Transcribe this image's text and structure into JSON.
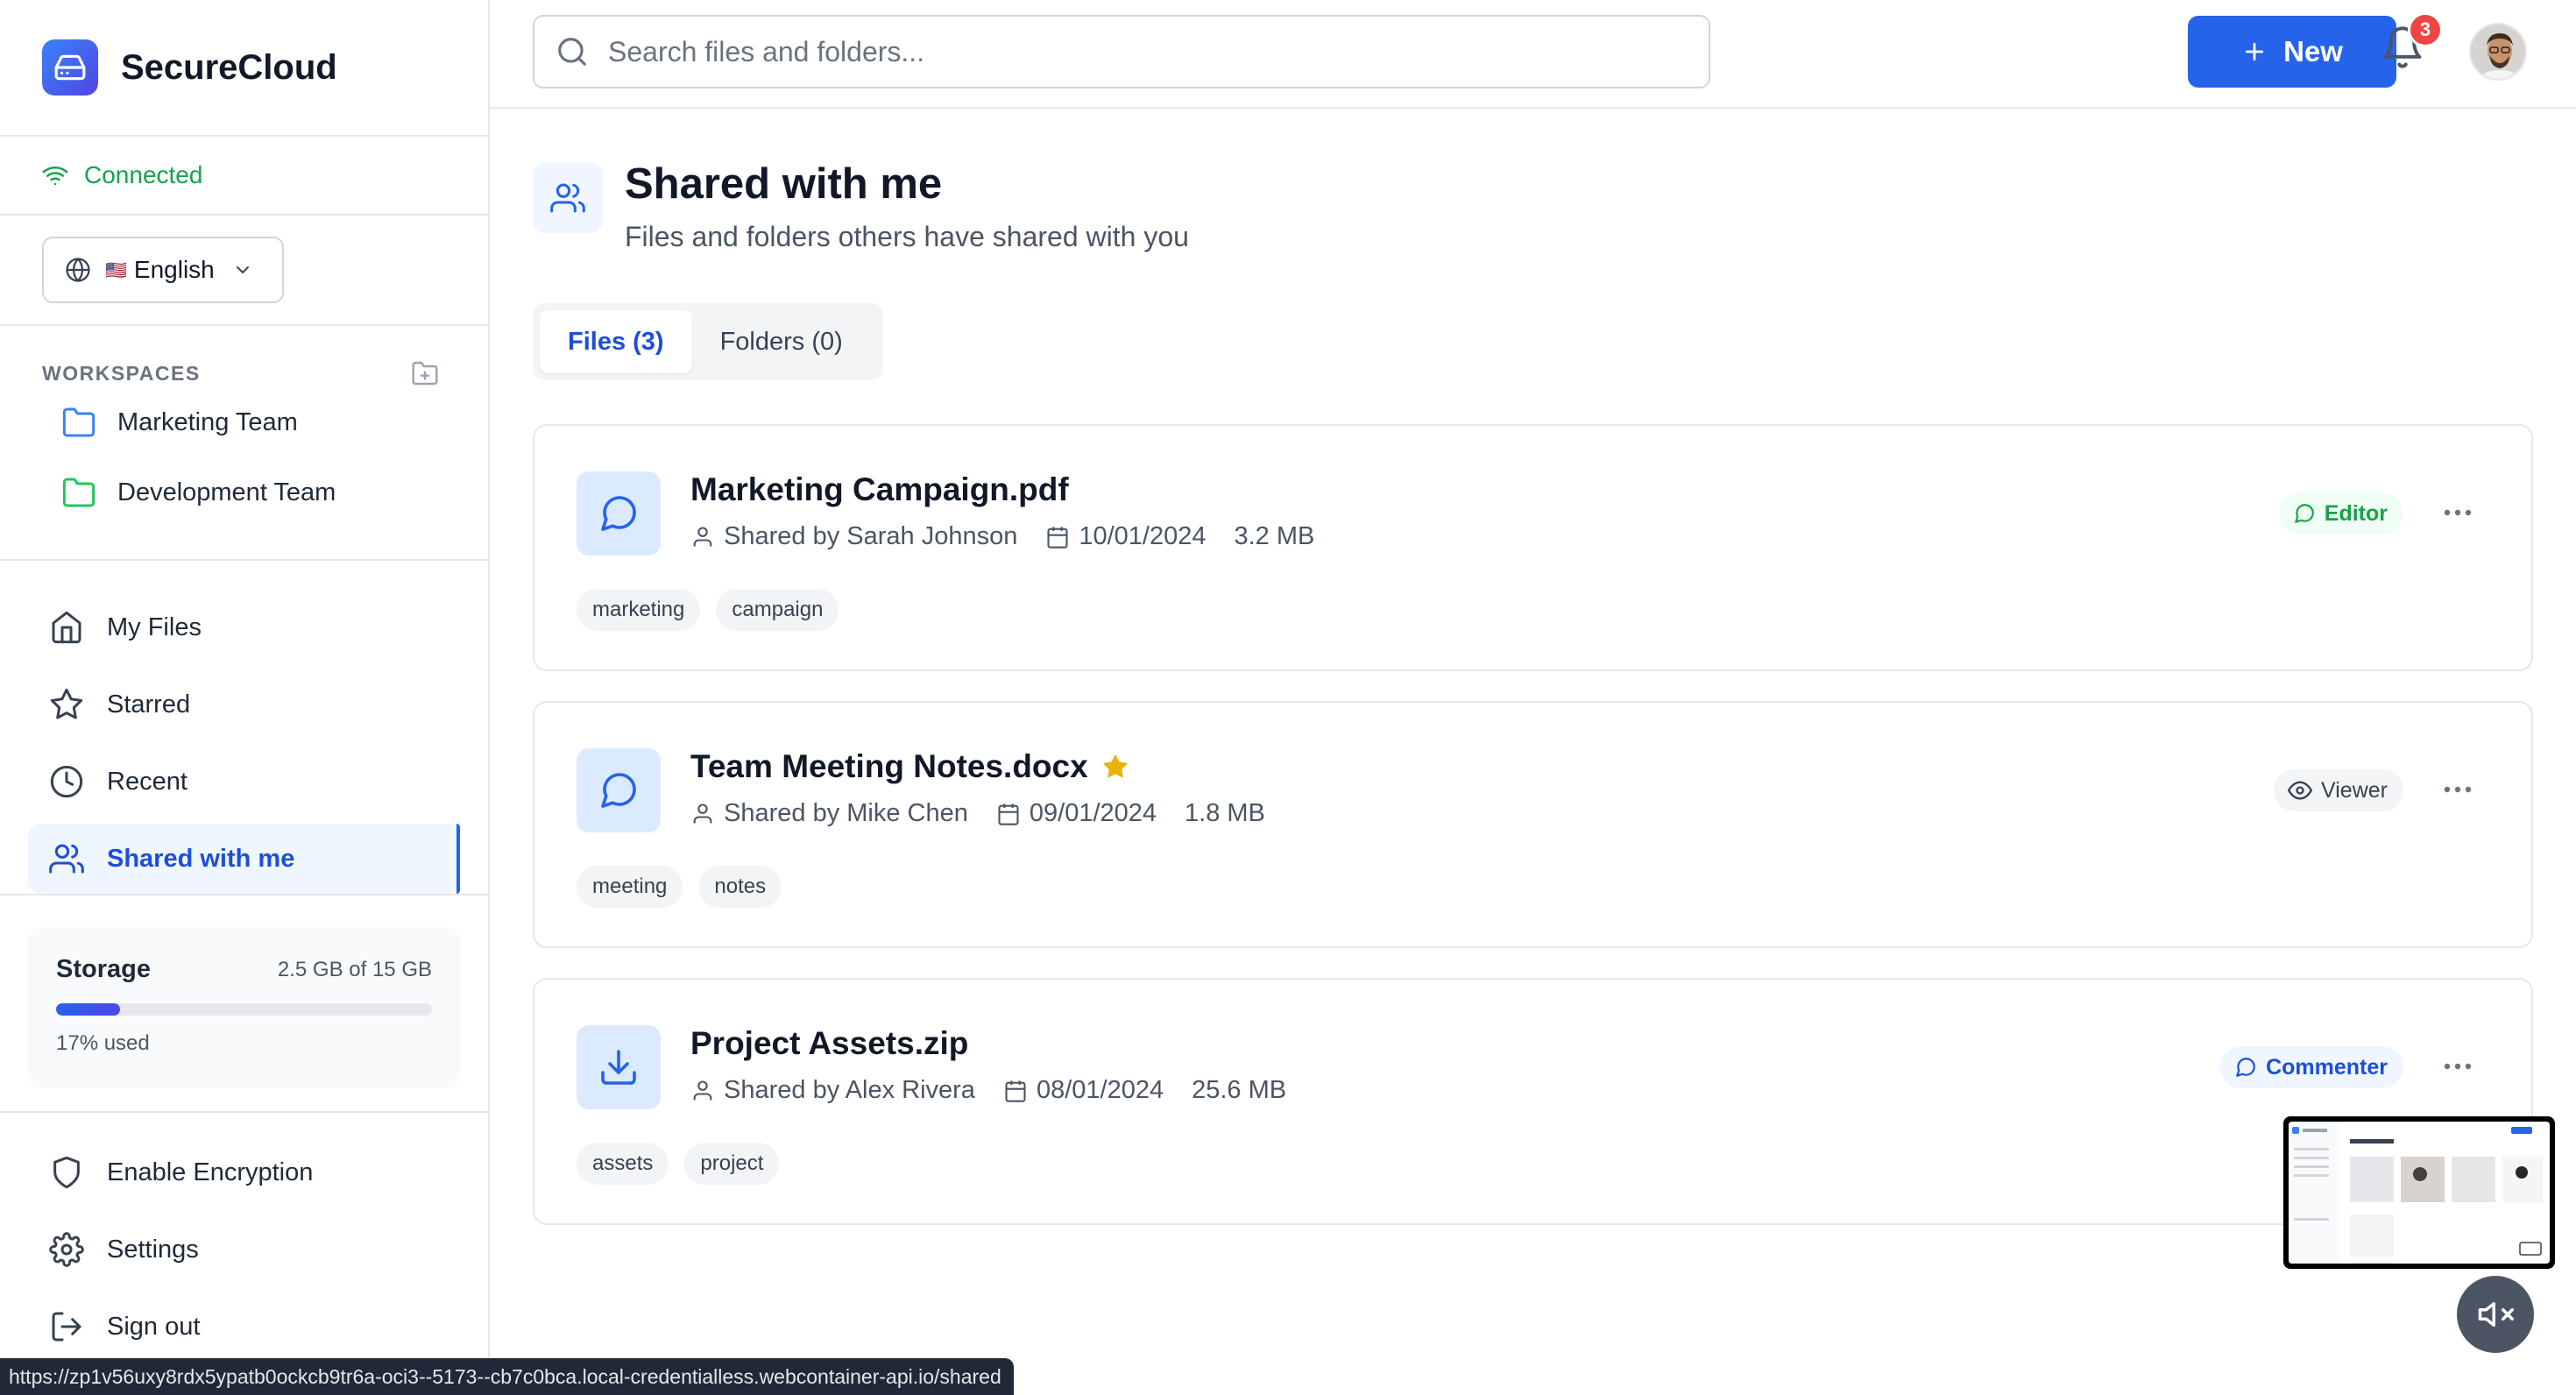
{
  "brand": {
    "name": "SecureCloud"
  },
  "connection": {
    "status": "Connected"
  },
  "language": {
    "flag": "🇺🇸",
    "label": "English"
  },
  "workspaces": {
    "title": "WORKSPACES",
    "items": [
      {
        "label": "Marketing Team",
        "color": "#3b82f6"
      },
      {
        "label": "Development Team",
        "color": "#22c55e"
      }
    ]
  },
  "nav": {
    "items": [
      {
        "label": "My Files",
        "icon": "home-icon"
      },
      {
        "label": "Starred",
        "icon": "star-icon"
      },
      {
        "label": "Recent",
        "icon": "clock-icon"
      },
      {
        "label": "Shared with me",
        "icon": "users-icon",
        "active": true
      }
    ]
  },
  "storage": {
    "title": "Storage",
    "amount": "2.5 GB of 15 GB",
    "used_label": "17% used",
    "used_fraction": 0.17
  },
  "bottom_nav": {
    "items": [
      {
        "label": "Enable Encryption",
        "icon": "shield-icon"
      },
      {
        "label": "Settings",
        "icon": "gear-icon"
      },
      {
        "label": "Sign out",
        "icon": "sign-out-icon"
      }
    ]
  },
  "topbar": {
    "search_placeholder": "Search files and folders...",
    "new_label": "New",
    "notification_count": "3"
  },
  "page": {
    "title": "Shared with me",
    "subtitle": "Files and folders others have shared with you"
  },
  "tabs": [
    {
      "label": "Files (3)",
      "active": true
    },
    {
      "label": "Folders (0)",
      "active": false
    }
  ],
  "files": [
    {
      "name": "Marketing Campaign.pdf",
      "icon": "message-icon",
      "shared_by": "Shared by Sarah Johnson",
      "date": "10/01/2024",
      "size": "3.2 MB",
      "starred": false,
      "tags": [
        "marketing",
        "campaign"
      ],
      "permission": "Editor"
    },
    {
      "name": "Team Meeting Notes.docx",
      "icon": "message-icon",
      "shared_by": "Shared by Mike Chen",
      "date": "09/01/2024",
      "size": "1.8 MB",
      "starred": true,
      "tags": [
        "meeting",
        "notes"
      ],
      "permission": "Viewer"
    },
    {
      "name": "Project Assets.zip",
      "icon": "download-icon",
      "shared_by": "Shared by Alex Rivera",
      "date": "08/01/2024",
      "size": "25.6 MB",
      "starred": false,
      "tags": [
        "assets",
        "project"
      ],
      "permission": "Commenter"
    }
  ],
  "status_bar": {
    "url": "https://zp1v56uxy8rdx5ypatb0ockcb9tr6a-oci3--5173--cb7c0bca.local-credentialless.webcontainer-api.io/shared"
  },
  "colors": {
    "accent": "#2563eb",
    "connected": "#16a34a",
    "badge": "#ef4444",
    "star": "#eab308"
  }
}
